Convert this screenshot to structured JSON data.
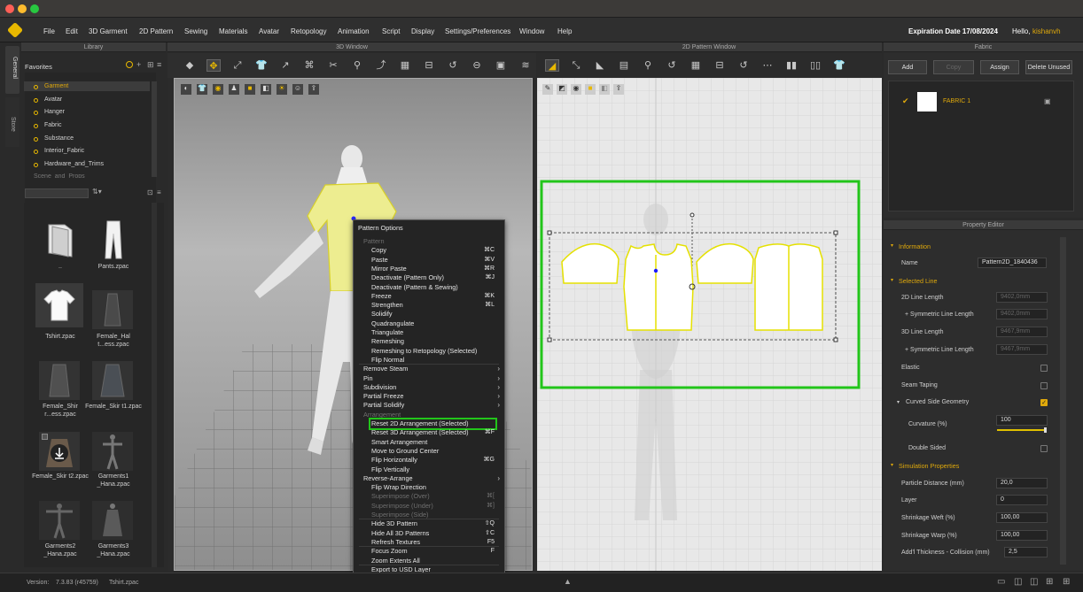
{
  "menubar": {
    "items": [
      "File",
      "Edit",
      "3D Garment",
      "2D Pattern",
      "Sewing",
      "Materials",
      "Avatar",
      "Retopology",
      "Animation",
      "Script",
      "Display",
      "Settings/Preferences",
      "Window",
      "Help"
    ],
    "expiration": "Expiration Date 17/08/2024",
    "hello": "Hello,",
    "username": "kishanvh"
  },
  "side_tabs": [
    "General",
    "Store"
  ],
  "library": {
    "title": "Library",
    "favorites_label": "Favorites",
    "items": [
      "Garment",
      "Avatar",
      "Hanger",
      "Fabric",
      "Substance",
      "Interior_Fabric",
      "Hardware_and_Trims",
      "Scene_and_Props"
    ],
    "thumbnails": [
      {
        "caption": "..",
        "icon": "folder-icon"
      },
      {
        "caption": "Pants.zpac",
        "icon": "pants-icon"
      },
      {
        "caption": "Tshirt.zpac",
        "icon": "tshirt-icon"
      },
      {
        "caption": "Female_Hal t...ess.zpac",
        "icon": "dress-icon"
      },
      {
        "caption": "Female_Shir r...ess.zpac",
        "icon": "dress-icon"
      },
      {
        "caption": "Female_Skir t1.zpac",
        "icon": "dress-icon"
      },
      {
        "caption": "Female_Skir t2.zpac",
        "icon": "download-icon"
      },
      {
        "caption": "Garments1 _Hana.zpac",
        "icon": "avatar-icon"
      },
      {
        "caption": "Garments2 _Hana.zpac",
        "icon": "avatar-icon"
      },
      {
        "caption": "Garments3 _Hana.zpac",
        "icon": "dress-icon"
      }
    ]
  },
  "window3d": {
    "title": "3D Window"
  },
  "window2d": {
    "title": "2D Pattern Window"
  },
  "context_menu": {
    "title": "Pattern Options",
    "groups": [
      {
        "label": "Pattern",
        "items": [
          {
            "label": "Copy",
            "shortcut": "⌘C"
          },
          {
            "label": "Paste",
            "shortcut": "⌘V"
          },
          {
            "label": "Mirror Paste",
            "shortcut": "⌘R"
          },
          {
            "label": "Deactivate (Pattern Only)",
            "shortcut": "⌘J"
          },
          {
            "label": "Deactivate (Pattern & Sewing)",
            "shortcut": ""
          },
          {
            "label": "Freeze",
            "shortcut": "⌘K"
          },
          {
            "label": "Strengthen",
            "shortcut": "⌘L"
          },
          {
            "label": "Solidify",
            "shortcut": ""
          },
          {
            "label": "Quadrangulate",
            "shortcut": ""
          },
          {
            "label": "Triangulate",
            "shortcut": ""
          },
          {
            "label": "Remeshing",
            "shortcut": ""
          },
          {
            "label": "Remeshing to Retopology (Selected)",
            "shortcut": ""
          },
          {
            "label": "Flip Normal",
            "shortcut": ""
          }
        ]
      },
      {
        "label": "",
        "items": [
          {
            "label": "Remove Steam",
            "submenu": true
          },
          {
            "label": "Pin",
            "submenu": true
          },
          {
            "label": "Subdivision",
            "submenu": true
          },
          {
            "label": "Partial Freeze",
            "submenu": true
          },
          {
            "label": "Partial Solidify",
            "submenu": true
          }
        ]
      },
      {
        "label": "Arrangement",
        "items": [
          {
            "label": "Reset 2D Arrangement (Selected)",
            "shortcut": "",
            "highlight": true
          },
          {
            "label": "Reset 3D Arrangement (Selected)",
            "shortcut": "⌘F"
          },
          {
            "label": "Smart Arrangement",
            "shortcut": ""
          },
          {
            "label": "Move to Ground Center",
            "shortcut": ""
          },
          {
            "label": "Flip Horizontally",
            "shortcut": "⌘G"
          },
          {
            "label": "Flip Vertically",
            "shortcut": ""
          },
          {
            "label": "Reverse-Arrange",
            "submenu": true
          },
          {
            "label": "Flip Wrap Direction",
            "shortcut": ""
          },
          {
            "label": "Superimpose (Over)",
            "shortcut": "⌘[",
            "disabled": true
          },
          {
            "label": "Superimpose (Under)",
            "shortcut": "⌘]",
            "disabled": true
          },
          {
            "label": "Superimpose (Side)",
            "shortcut": "",
            "disabled": true
          }
        ]
      },
      {
        "label": "",
        "items": [
          {
            "label": "Hide 3D Pattern",
            "shortcut": "⇧Q"
          },
          {
            "label": "Hide All 3D Patterns",
            "shortcut": "⇧C"
          },
          {
            "label": "Refresh Textures",
            "shortcut": "F5"
          }
        ]
      },
      {
        "label": "",
        "items": [
          {
            "label": "Focus Zoom",
            "shortcut": "F"
          },
          {
            "label": "Zoom Extents All",
            "shortcut": ""
          }
        ]
      },
      {
        "label": "",
        "items": [
          {
            "label": "Export to USD Layer",
            "shortcut": ""
          }
        ]
      }
    ]
  },
  "fabric_panel": {
    "title": "Fabric",
    "buttons": [
      "Add",
      "Copy",
      "Assign",
      "Delete Unused"
    ],
    "items": [
      {
        "name": "FABRIC 1"
      }
    ]
  },
  "property_editor": {
    "title": "Property Editor",
    "information": {
      "header": "Information",
      "name_label": "Name",
      "name_value": "Pattern2D_1840436"
    },
    "selected_line": {
      "header": "Selected Line",
      "rows": [
        {
          "label": "2D Line Length",
          "value": "9402,0mm"
        },
        {
          "label": "+ Symmetric Line Length",
          "value": "9402,0mm"
        },
        {
          "label": "3D Line Length",
          "value": "9467,9mm"
        },
        {
          "label": "+ Symmetric Line Length",
          "value": "9467,9mm"
        }
      ],
      "elastic": "Elastic",
      "seam_taping": "Seam Taping",
      "curved": "Curved Side Geometry",
      "curvature_label": "Curvature (%)",
      "curvature_value": "100",
      "curvature_fraction": 1.0,
      "double_sided": "Double Sided"
    },
    "simulation": {
      "header": "Simulation Properties",
      "rows": [
        {
          "label": "Particle Distance (mm)",
          "value": "20,0"
        },
        {
          "label": "Layer",
          "value": "0"
        },
        {
          "label": "Shrinkage Weft (%)",
          "value": "100,00"
        },
        {
          "label": "Shrinkage Warp (%)",
          "value": "100,00"
        },
        {
          "label": "Add'l Thickness - Collision (mm)",
          "value": "2,5"
        }
      ]
    }
  },
  "statusbar": {
    "version_label": "Version:",
    "version": "7.3.83 (r45759)",
    "file": "Tshirt.zpac"
  },
  "colors": {
    "accent": "#e0a90b",
    "highlight": "#22c51a",
    "pattern_fill": "#ffffff",
    "pattern_outline": "#e5e100"
  }
}
